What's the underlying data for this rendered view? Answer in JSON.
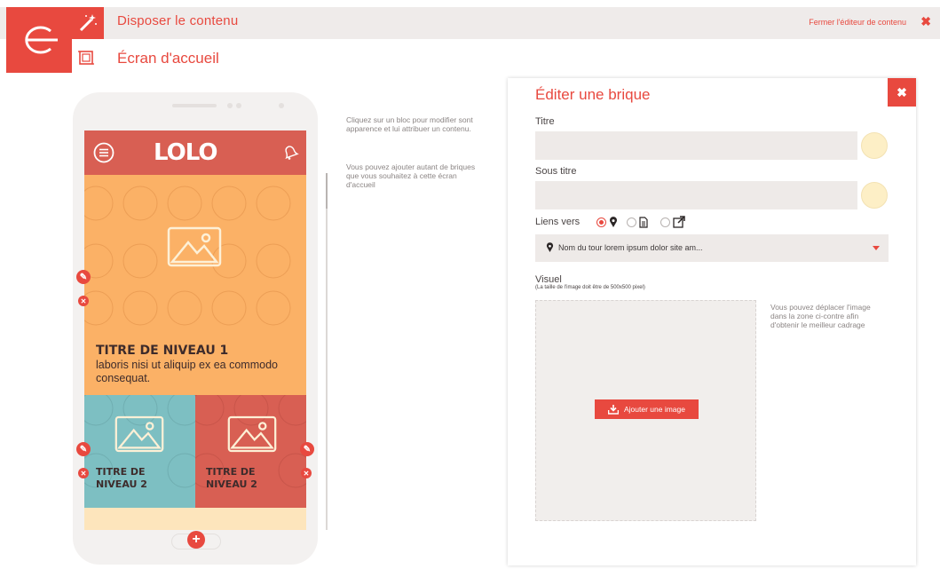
{
  "top": {
    "title": "Disposer le contenu",
    "subtitle": "Écran d'accueil",
    "close_editor": "Fermer l'éditeur de contenu",
    "close_glyph": "✖"
  },
  "phone": {
    "logo": "LOLO",
    "block1_title": "TITRE DE NIVEAU 1",
    "block1_body": "laboris nisi ut aliquip ex ea commodo consequat.",
    "block2_title": "TITRE DE NIVEAU 2",
    "block3_title": "TITRE DE NIVEAU 2",
    "add_glyph": "+",
    "edit_glyph": "✎",
    "delete_glyph": "✕"
  },
  "help": {
    "text1": "Cliquez sur un bloc pour modifier sont apparence et lui attribuer un contenu.",
    "text2": "Vous pouvez ajouter autant de briques que vous souhaitez à cette écran d'accueil"
  },
  "panel": {
    "title": "Éditer une brique",
    "close_glyph": "✖",
    "titre_label": "Titre",
    "titre_value": "",
    "sous_titre_label": "Sous titre",
    "sous_titre_value": "",
    "liens_label": "Liens vers",
    "select_value": "Nom du  tour lorem ipsum dolor site am...",
    "visuel_label": "Visuel",
    "visuel_note": "(La taille de l'image doit être de 500x500 pixel)",
    "upload_label": "Ajouter une image",
    "side_help": "Vous pouvez déplacer l'image dans la zone ci-contre afin d'obtenir le meilleur cadrage"
  },
  "colors": {
    "accent": "#e8493f",
    "orange_block": "#fbb166",
    "blue_block": "#7dbfc2",
    "red_block": "#d85f53",
    "swatch": "#fdefc6"
  },
  "icons": [
    "app-logo-icon",
    "magic-wand-icon",
    "frame-icon",
    "menu-icon",
    "bell-icon",
    "image-placeholder-icon",
    "pencil-icon",
    "remove-icon",
    "plus-icon",
    "map-pin-icon",
    "document-icon",
    "external-link-icon",
    "download-icon",
    "close-icon"
  ]
}
